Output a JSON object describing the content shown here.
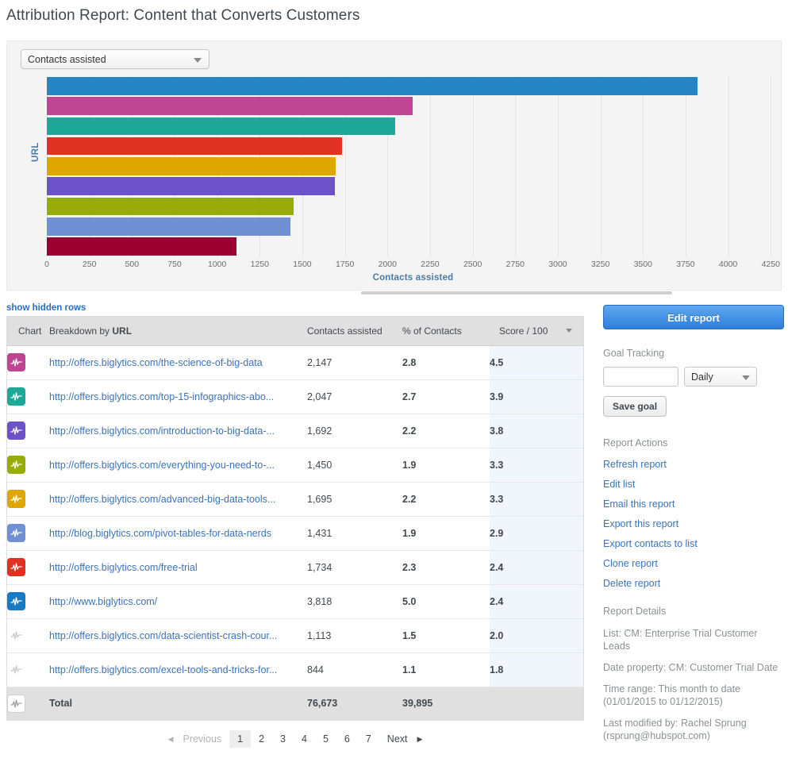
{
  "page_title": "Attribution Report: Content that Converts Customers",
  "chart_panel": {
    "metric_select_value": "Contacts assisted",
    "caret_icon": "chevron-down-icon"
  },
  "chart_data": {
    "type": "bar",
    "orientation": "horizontal",
    "title": "",
    "xlabel": "Contacts assisted",
    "ylabel": "URL",
    "xlim": [
      0,
      4300
    ],
    "grid": true,
    "legend": "none",
    "categories": [
      "http://www.biglytics.com/",
      "http://offers.biglytics.com/the-science-of-big-data",
      "http://offers.biglytics.com/top-15-infographics-abo...",
      "http://offers.biglytics.com/free-trial",
      "http://offers.biglytics.com/advanced-big-data-tools...",
      "http://offers.biglytics.com/introduction-to-big-data-...",
      "http://offers.biglytics.com/everything-you-need-to-...",
      "http://blog.biglytics.com/pivot-tables-for-data-nerds",
      "http://offers.biglytics.com/data-scientist-crash-cour..."
    ],
    "values": [
      3818,
      2147,
      2047,
      1734,
      1695,
      1692,
      1450,
      1431,
      1113
    ],
    "colors": [
      "#2585c4",
      "#bd4592",
      "#1fa898",
      "#e03223",
      "#dea700",
      "#6b52c8",
      "#97ac09",
      "#6f91d4",
      "#9c0033"
    ],
    "xticks": [
      0,
      250,
      500,
      750,
      1000,
      1250,
      1500,
      1750,
      2000,
      2250,
      2500,
      2750,
      3000,
      3250,
      3500,
      3750,
      4000,
      4250
    ]
  },
  "show_hidden_rows_label": "show hidden rows",
  "table": {
    "columns": {
      "chart": "Chart",
      "breakdown_prefix": "Breakdown by ",
      "breakdown_bold": "URL",
      "contacts_assisted": "Contacts assisted",
      "pct_of_contacts": "% of Contacts",
      "score": "Score / 100",
      "sort_icon": "chevron-down-icon"
    },
    "rows": [
      {
        "icon": "sparkline-icon",
        "icon_color": "#bd4592",
        "url": "http://offers.biglytics.com/the-science-of-big-data",
        "contacts": "2,147",
        "pct": "2.8",
        "score": "4.5",
        "faded": false
      },
      {
        "icon": "sparkline-icon",
        "icon_color": "#1fa898",
        "url": "http://offers.biglytics.com/top-15-infographics-abo...",
        "contacts": "2,047",
        "pct": "2.7",
        "score": "3.9",
        "faded": false
      },
      {
        "icon": "sparkline-icon",
        "icon_color": "#6b52c8",
        "url": "http://offers.biglytics.com/introduction-to-big-data-...",
        "contacts": "1,692",
        "pct": "2.2",
        "score": "3.8",
        "faded": false
      },
      {
        "icon": "sparkline-icon",
        "icon_color": "#97ac09",
        "url": "http://offers.biglytics.com/everything-you-need-to-...",
        "contacts": "1,450",
        "pct": "1.9",
        "score": "3.3",
        "faded": false
      },
      {
        "icon": "sparkline-icon",
        "icon_color": "#dea700",
        "url": "http://offers.biglytics.com/advanced-big-data-tools...",
        "contacts": "1,695",
        "pct": "2.2",
        "score": "3.3",
        "faded": false
      },
      {
        "icon": "sparkline-icon",
        "icon_color": "#6f91d4",
        "url": "http://blog.biglytics.com/pivot-tables-for-data-nerds",
        "contacts": "1,431",
        "pct": "1.9",
        "score": "2.9",
        "faded": false
      },
      {
        "icon": "sparkline-icon",
        "icon_color": "#e03223",
        "url": "http://offers.biglytics.com/free-trial",
        "contacts": "1,734",
        "pct": "2.3",
        "score": "2.4",
        "faded": false
      },
      {
        "icon": "sparkline-icon",
        "icon_color": "#1879c4",
        "url": "http://www.biglytics.com/",
        "contacts": "3,818",
        "pct": "5.0",
        "score": "2.4",
        "faded": false
      },
      {
        "icon": "sparkline-icon",
        "icon_color": "#d8d8d8",
        "url": "http://offers.biglytics.com/data-scientist-crash-cour...",
        "contacts": "1,113",
        "pct": "1.5",
        "score": "2.0",
        "faded": true
      },
      {
        "icon": "sparkline-icon",
        "icon_color": "#d8d8d8",
        "url": "http://offers.biglytics.com/excel-tools-and-tricks-for...",
        "contacts": "844",
        "pct": "1.1",
        "score": "1.8",
        "faded": true
      }
    ],
    "total": {
      "icon": "sparkline-icon",
      "label": "Total",
      "contacts": "76,673",
      "pct": "39,895",
      "score": ""
    }
  },
  "pagination": {
    "previous": "Previous",
    "next": "Next",
    "pages": [
      "1",
      "2",
      "3",
      "4",
      "5",
      "6",
      "7"
    ],
    "active_page": "1",
    "prev_arrow": "triangle-left-icon",
    "next_arrow": "triangle-right-icon"
  },
  "sidebar": {
    "edit_report_label": "Edit report",
    "goal_tracking_heading": "Goal Tracking",
    "goal_input_value": "",
    "frequency_value": "Daily",
    "save_goal_label": "Save goal",
    "report_actions_heading": "Report Actions",
    "actions": [
      "Refresh report",
      "Edit list",
      "Email this report",
      "Export this report",
      "Export contacts to list",
      "Clone report",
      "Delete report"
    ],
    "report_details_heading": "Report Details",
    "details": [
      "List: CM: Enterprise Trial Customer Leads",
      "Date property: CM: Customer Trial Date",
      "Time range: This month to date (01/01/2015 to 01/12/2015)",
      "Last modified by: Rachel Sprung (rsprung@hubspot.com)"
    ]
  }
}
